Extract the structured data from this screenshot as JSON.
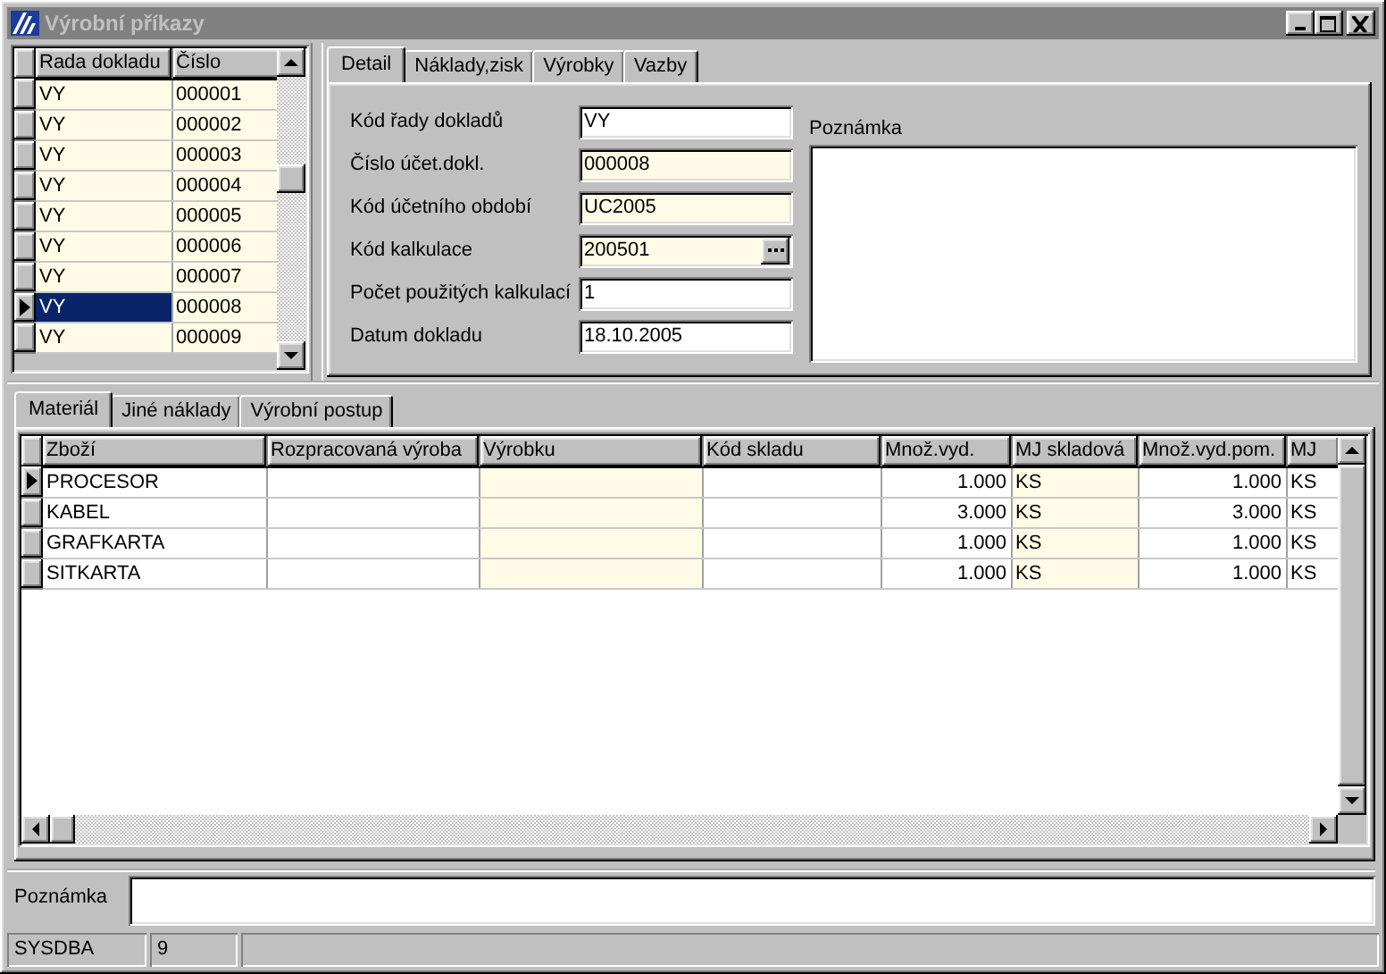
{
  "window": {
    "title": "Výrobní příkazy"
  },
  "left_grid": {
    "columns": [
      {
        "label": "Rada dokladu",
        "readonly": true
      },
      {
        "label": "Číslo",
        "readonly": true
      }
    ],
    "rows": [
      {
        "cells": [
          "VY",
          "000001"
        ],
        "selected": false
      },
      {
        "cells": [
          "VY",
          "000002"
        ],
        "selected": false
      },
      {
        "cells": [
          "VY",
          "000003"
        ],
        "selected": false
      },
      {
        "cells": [
          "VY",
          "000004"
        ],
        "selected": false
      },
      {
        "cells": [
          "VY",
          "000005"
        ],
        "selected": false
      },
      {
        "cells": [
          "VY",
          "000006"
        ],
        "selected": false
      },
      {
        "cells": [
          "VY",
          "000007"
        ],
        "selected": false
      },
      {
        "cells": [
          "VY",
          "000008"
        ],
        "selected": true
      },
      {
        "cells": [
          "VY",
          "000009"
        ],
        "selected": false
      }
    ]
  },
  "detail_tabs": [
    {
      "label": "Detail",
      "selected": true
    },
    {
      "label": "Náklady,zisk",
      "selected": false
    },
    {
      "label": "Výrobky",
      "selected": false
    },
    {
      "label": "Vazby",
      "selected": false
    }
  ],
  "detail_fields": [
    {
      "label": "Kód řady dokladů",
      "value": "VY",
      "readonly": false,
      "lookup": false
    },
    {
      "label": "Číslo účet.dokl.",
      "value": "000008",
      "readonly": true,
      "lookup": false
    },
    {
      "label": "Kód účetního období",
      "value": "UC2005",
      "readonly": true,
      "lookup": false
    },
    {
      "label": "Kód kalkulace",
      "value": "200501",
      "readonly": true,
      "lookup": true
    },
    {
      "label": "Počet použitých kalkulací",
      "value": "1",
      "readonly": false,
      "lookup": false
    },
    {
      "label": "Datum dokladu",
      "value": "18.10.2005",
      "readonly": false,
      "lookup": false
    }
  ],
  "detail_note": {
    "label": "Poznámka"
  },
  "bottom_tabs": [
    {
      "label": "Materiál",
      "selected": true
    },
    {
      "label": "Jiné náklady",
      "selected": false
    },
    {
      "label": "Výrobní postup",
      "selected": false
    }
  ],
  "material_grid": {
    "columns": [
      {
        "label": "Zboží",
        "readonly": false,
        "kind": "text"
      },
      {
        "label": "Rozpracovaná výroba",
        "readonly": false,
        "kind": "text"
      },
      {
        "label": "Výrobku",
        "readonly": true,
        "kind": "text"
      },
      {
        "label": "Kód skladu",
        "readonly": false,
        "kind": "text"
      },
      {
        "label": "Množ.vyd.",
        "readonly": false,
        "kind": "number"
      },
      {
        "label": "MJ skladová",
        "readonly": true,
        "kind": "text"
      },
      {
        "label": "Množ.vyd.pom.",
        "readonly": false,
        "kind": "number"
      },
      {
        "label": "MJ",
        "readonly": false,
        "kind": "text"
      }
    ],
    "rows": [
      {
        "cells": [
          "PROCESOR",
          null,
          null,
          null,
          "1.000",
          "KS",
          "1.000",
          "KS"
        ],
        "selected": true
      },
      {
        "cells": [
          "KABEL",
          null,
          null,
          null,
          "3.000",
          "KS",
          "3.000",
          "KS"
        ],
        "selected": false
      },
      {
        "cells": [
          "GRAFKARTA",
          null,
          null,
          null,
          "1.000",
          "KS",
          "1.000",
          "KS"
        ],
        "selected": false
      },
      {
        "cells": [
          "SITKARTA",
          null,
          null,
          null,
          "1.000",
          "KS",
          "1.000",
          "KS"
        ],
        "selected": false
      }
    ]
  },
  "note_bar": {
    "label": "Poznámka"
  },
  "status_bar": [
    "SYSDBA",
    "9"
  ]
}
